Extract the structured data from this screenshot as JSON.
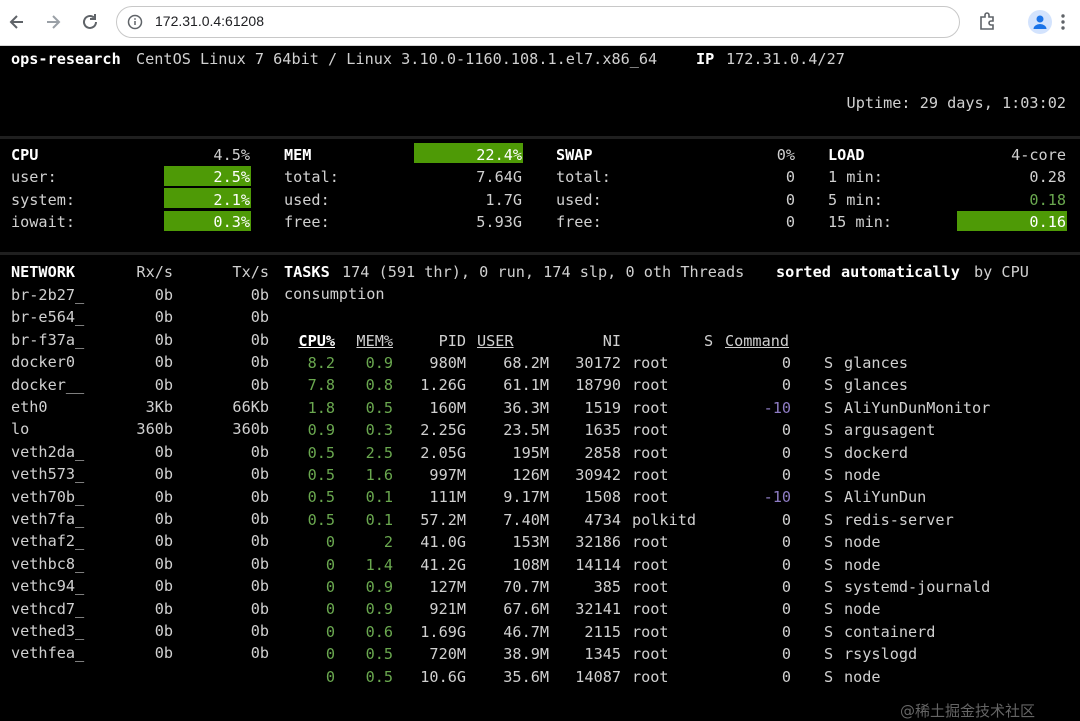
{
  "browser": {
    "url": "172.31.0.4:61208",
    "icons": [
      "back-arrow-icon",
      "forward-arrow-icon",
      "reload-icon",
      "site-info-icon",
      "extensions-icon",
      "profile-icon",
      "menu-icon"
    ]
  },
  "header": {
    "hostname": "ops-research",
    "os": "CentOS Linux 7 64bit / Linux 3.10.0-1160.108.1.el7.x86_64",
    "ip_label": "IP",
    "ip": "172.31.0.4/27",
    "uptime": "Uptime: 29 days, 1:03:02"
  },
  "cpu": {
    "title": "CPU",
    "total": "4.5%",
    "rows": [
      {
        "label": "user:",
        "value": "2.5%"
      },
      {
        "label": "system:",
        "value": "2.1%"
      },
      {
        "label": "iowait:",
        "value": "0.3%"
      }
    ]
  },
  "mem": {
    "title": "MEM",
    "total": "22.4%",
    "rows": [
      {
        "label": "total:",
        "value": "7.64G"
      },
      {
        "label": "used:",
        "value": "1.7G"
      },
      {
        "label": "free:",
        "value": "5.93G"
      }
    ]
  },
  "swap": {
    "title": "SWAP",
    "total": "0%",
    "rows": [
      {
        "label": "total:",
        "value": "0"
      },
      {
        "label": "used:",
        "value": "0"
      },
      {
        "label": "free:",
        "value": "0"
      }
    ]
  },
  "load": {
    "title": "LOAD",
    "total": "4-core",
    "rows": [
      {
        "label": "1 min:",
        "value": "0.28"
      },
      {
        "label": "5 min:",
        "value": "0.18"
      },
      {
        "label": "15 min:",
        "value": "0.16"
      }
    ]
  },
  "network": {
    "title": "NETWORK",
    "rx_label": "Rx/s",
    "tx_label": "Tx/s",
    "rows": [
      [
        "br-2b27_",
        "0b",
        "0b"
      ],
      [
        "br-e564_",
        "0b",
        "0b"
      ],
      [
        "br-f37a_",
        "0b",
        "0b"
      ],
      [
        "docker0",
        "0b",
        "0b"
      ],
      [
        "docker__",
        "0b",
        "0b"
      ],
      [
        "eth0",
        "3Kb",
        "66Kb"
      ],
      [
        "lo",
        "360b",
        "360b"
      ],
      [
        "veth2da_",
        "0b",
        "0b"
      ],
      [
        "veth573_",
        "0b",
        "0b"
      ],
      [
        "veth70b_",
        "0b",
        "0b"
      ],
      [
        "veth7fa_",
        "0b",
        "0b"
      ],
      [
        "vethaf2_",
        "0b",
        "0b"
      ],
      [
        "vethbc8_",
        "0b",
        "0b"
      ],
      [
        "vethc94_",
        "0b",
        "0b"
      ],
      [
        "vethcd7_",
        "0b",
        "0b"
      ],
      [
        "vethed3_",
        "0b",
        "0b"
      ],
      [
        "vethfea_",
        "0b",
        "0b"
      ]
    ]
  },
  "tasks": {
    "label": "TASKS",
    "summary": "174 (591 thr), 0 run, 174 slp, 0 oth Threads",
    "sorted": "sorted",
    "automatically": "automatically",
    "by": "by CPU",
    "line2": "consumption"
  },
  "processes": {
    "columns": [
      "CPU%",
      "MEM%",
      "PID",
      "USER",
      "NI",
      "S",
      "Command"
    ],
    "rows": [
      [
        "8.2",
        "0.9",
        "980M",
        "68.2M",
        "30172",
        "root",
        "0",
        "S",
        "glances"
      ],
      [
        "7.8",
        "0.8",
        "1.26G",
        "61.1M",
        "18790",
        "root",
        "0",
        "S",
        "glances"
      ],
      [
        "1.8",
        "0.5",
        "160M",
        "36.3M",
        "1519",
        "root",
        "-10",
        "S",
        "AliYunDunMonitor"
      ],
      [
        "0.9",
        "0.3",
        "2.25G",
        "23.5M",
        "1635",
        "root",
        "0",
        "S",
        "argusagent"
      ],
      [
        "0.5",
        "2.5",
        "2.05G",
        "195M",
        "2858",
        "root",
        "0",
        "S",
        "dockerd"
      ],
      [
        "0.5",
        "1.6",
        "997M",
        "126M",
        "30942",
        "root",
        "0",
        "S",
        "node"
      ],
      [
        "0.5",
        "0.1",
        "111M",
        "9.17M",
        "1508",
        "root",
        "-10",
        "S",
        "AliYunDun"
      ],
      [
        "0.5",
        "0.1",
        "57.2M",
        "7.40M",
        "4734",
        "polkitd",
        "0",
        "S",
        "redis-server"
      ],
      [
        "0",
        "2",
        "41.0G",
        "153M",
        "32186",
        "root",
        "0",
        "S",
        "node"
      ],
      [
        "0",
        "1.4",
        "41.2G",
        "108M",
        "14114",
        "root",
        "0",
        "S",
        "node"
      ],
      [
        "0",
        "0.9",
        "127M",
        "70.7M",
        "385",
        "root",
        "0",
        "S",
        "systemd-journald"
      ],
      [
        "0",
        "0.9",
        "921M",
        "67.6M",
        "32141",
        "root",
        "0",
        "S",
        "node"
      ],
      [
        "0",
        "0.6",
        "1.69G",
        "46.7M",
        "2115",
        "root",
        "0",
        "S",
        "containerd"
      ],
      [
        "0",
        "0.5",
        "720M",
        "38.9M",
        "1345",
        "root",
        "0",
        "S",
        "rsyslogd"
      ],
      [
        "0",
        "0.5",
        "10.6G",
        "35.6M",
        "14087",
        "root",
        "0",
        "S",
        "node"
      ]
    ]
  },
  "watermark": "@稀土掘金技术社区",
  "colors": {
    "highlight": "#4e9a06",
    "green_text": "#6aa84f",
    "nice_neg": "#8e7cc3",
    "background": "#000000"
  }
}
